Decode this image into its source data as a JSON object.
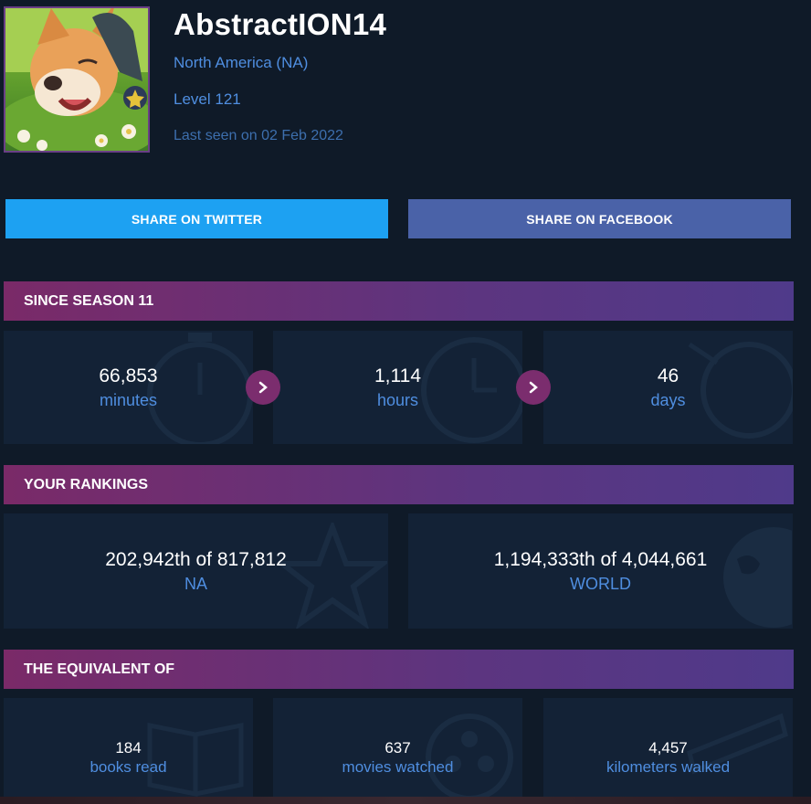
{
  "profile": {
    "name": "AbstractION14",
    "region": "North America (NA)",
    "level": "Level 121",
    "last_seen": "Last seen on 02 Feb 2022"
  },
  "share": {
    "twitter": "SHARE ON TWITTER",
    "facebook": "SHARE ON FACEBOOK"
  },
  "season": {
    "title": "SINCE SEASON 11",
    "stats": [
      {
        "value": "66,853",
        "label": "minutes"
      },
      {
        "value": "1,114",
        "label": "hours"
      },
      {
        "value": "46",
        "label": "days"
      }
    ]
  },
  "rankings": {
    "title": "YOUR RANKINGS",
    "items": [
      {
        "value": "202,942th of 817,812",
        "label": "NA"
      },
      {
        "value": "1,194,333th of 4,044,661",
        "label": "WORLD"
      }
    ]
  },
  "equivalent": {
    "title": "THE EQUIVALENT OF",
    "items": [
      {
        "value": "184",
        "label": "books read"
      },
      {
        "value": "637",
        "label": "movies watched"
      },
      {
        "value": "4,457",
        "label": "kilometers walked"
      }
    ]
  },
  "colors": {
    "background": "#0f1a28",
    "card": "#132236",
    "accent_blue": "#4f8ee0",
    "twitter": "#1da1f2",
    "facebook": "#4a62a8",
    "section_gradient_start": "#7a2a68",
    "section_gradient_end": "#4f3a8a",
    "arrow": "#7b2d6e"
  },
  "icons": [
    "corgi-avatar",
    "chevron-right-icon",
    "stopwatch-icon",
    "clock-icon",
    "star-icon",
    "globe-icon",
    "book-icon",
    "film-reel-icon",
    "road-icon"
  ]
}
